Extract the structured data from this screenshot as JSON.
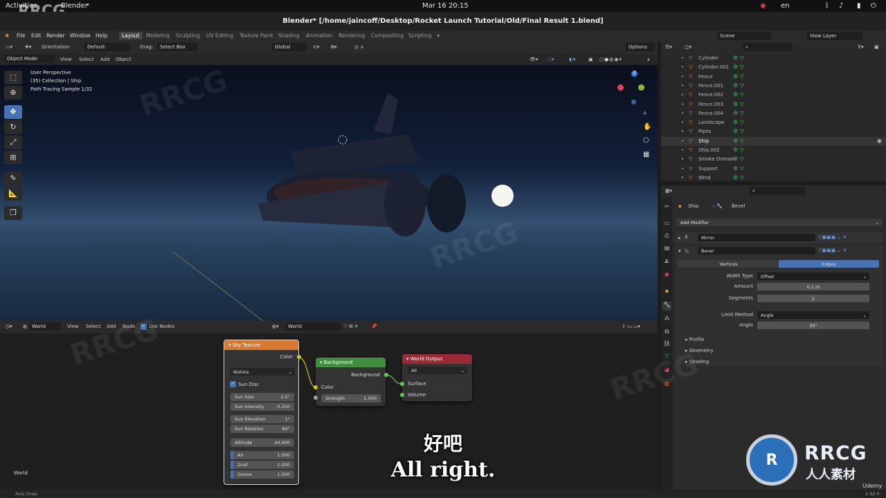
{
  "system": {
    "activities": "Activities",
    "app": "Blender",
    "clock": "Mar 16  20:15",
    "lang": "en"
  },
  "window": {
    "title": "Blender* [/home/jaincoff/Desktop/Rocket Launch Tutorial/Old/Final Result 1.blend]"
  },
  "menu": {
    "items": [
      "File",
      "Edit",
      "Render",
      "Window",
      "Help"
    ],
    "workspaces": [
      "Layout",
      "Modeling",
      "Sculpting",
      "UV Editing",
      "Texture Paint",
      "Shading",
      "Animation",
      "Rendering",
      "Compositing",
      "Scripting"
    ],
    "active_workspace": "Layout",
    "scene": "Scene",
    "view_layer": "View Layer"
  },
  "viewport_header": {
    "orientation_label": "Orientation:",
    "orientation_value": "Default",
    "drag_label": "Drag:",
    "drag_value": "Select Box",
    "transform": "Global",
    "options": "Options",
    "mode": "Object Mode",
    "menus": [
      "View",
      "Select",
      "Add",
      "Object"
    ]
  },
  "viewport_overlay": {
    "line1": "User Perspective",
    "line2": "(35) Collection | Ship",
    "line3": "Path Tracing Sample 1/32",
    "gizmo_z": "Z"
  },
  "node_header": {
    "type": "World",
    "menus": [
      "View",
      "Select",
      "Add",
      "Node"
    ],
    "use_nodes": "Use Nodes",
    "world_name": "World"
  },
  "nodes": {
    "sky": {
      "title": "Sky Texture",
      "color_out": "Color",
      "sky_type": "Nishita",
      "sun_disc": "Sun Disc",
      "fields": [
        {
          "label": "Sun Size",
          "value": "2.5°"
        },
        {
          "label": "Sun Intensity",
          "value": "0.250"
        },
        {
          "label": "Sun Elevation",
          "value": "1°"
        },
        {
          "label": "Sun Rotation",
          "value": "60°"
        },
        {
          "label": "Altitude",
          "value": "44.900"
        },
        {
          "label": "Air",
          "value": "1.000"
        },
        {
          "label": "Dust",
          "value": "1.000"
        },
        {
          "label": "Ozone",
          "value": "1.000"
        }
      ]
    },
    "background": {
      "title": "Background",
      "out": "Background",
      "color": "Color",
      "strength_label": "Strength",
      "strength_value": "1.000"
    },
    "output": {
      "title": "World Output",
      "target": "All",
      "surface": "Surface",
      "volume": "Volume"
    }
  },
  "node_corner_label": "World",
  "outliner": {
    "items": [
      {
        "name": "Cylinder",
        "sel": false
      },
      {
        "name": "Cylinder.001",
        "sel": false
      },
      {
        "name": "Fence",
        "sel": false
      },
      {
        "name": "Fence.001",
        "sel": false
      },
      {
        "name": "Fence.002",
        "sel": false
      },
      {
        "name": "Fence.003",
        "sel": false
      },
      {
        "name": "Fence.004",
        "sel": false
      },
      {
        "name": "Landscape",
        "sel": false
      },
      {
        "name": "Pipes",
        "sel": false
      },
      {
        "name": "Ship",
        "sel": true
      },
      {
        "name": "Ship.002",
        "sel": false
      },
      {
        "name": "Smoke Domain",
        "sel": false
      },
      {
        "name": "Support",
        "sel": false
      },
      {
        "name": "Wind",
        "sel": false
      }
    ]
  },
  "properties": {
    "object": "Ship",
    "modifier_tab": "Bevel",
    "add_modifier": "Add Modifier",
    "mirror": "Mirror",
    "bevel": "Bevel",
    "seg_vertices": "Vertices",
    "seg_edges": "Edges",
    "width_type_label": "Width Type",
    "width_type": "Offset",
    "amount_label": "Amount",
    "amount": "0.1 m",
    "segments_label": "Segments",
    "segments": "2",
    "limit_label": "Limit Method",
    "limit": "Angle",
    "angle_label": "Angle",
    "angle": "30°",
    "panels": [
      "Profile",
      "Geometry",
      "Shading"
    ]
  },
  "status": {
    "left": "Axis Snap",
    "version": "2.92.0"
  },
  "subtitle": {
    "zh": "好吧",
    "en": "All right."
  },
  "watermark": {
    "logo": "RRCG",
    "brand": "RRCG",
    "brand_sub": "人人素材",
    "corner": "RRCG",
    "udemy": "Udemy"
  }
}
